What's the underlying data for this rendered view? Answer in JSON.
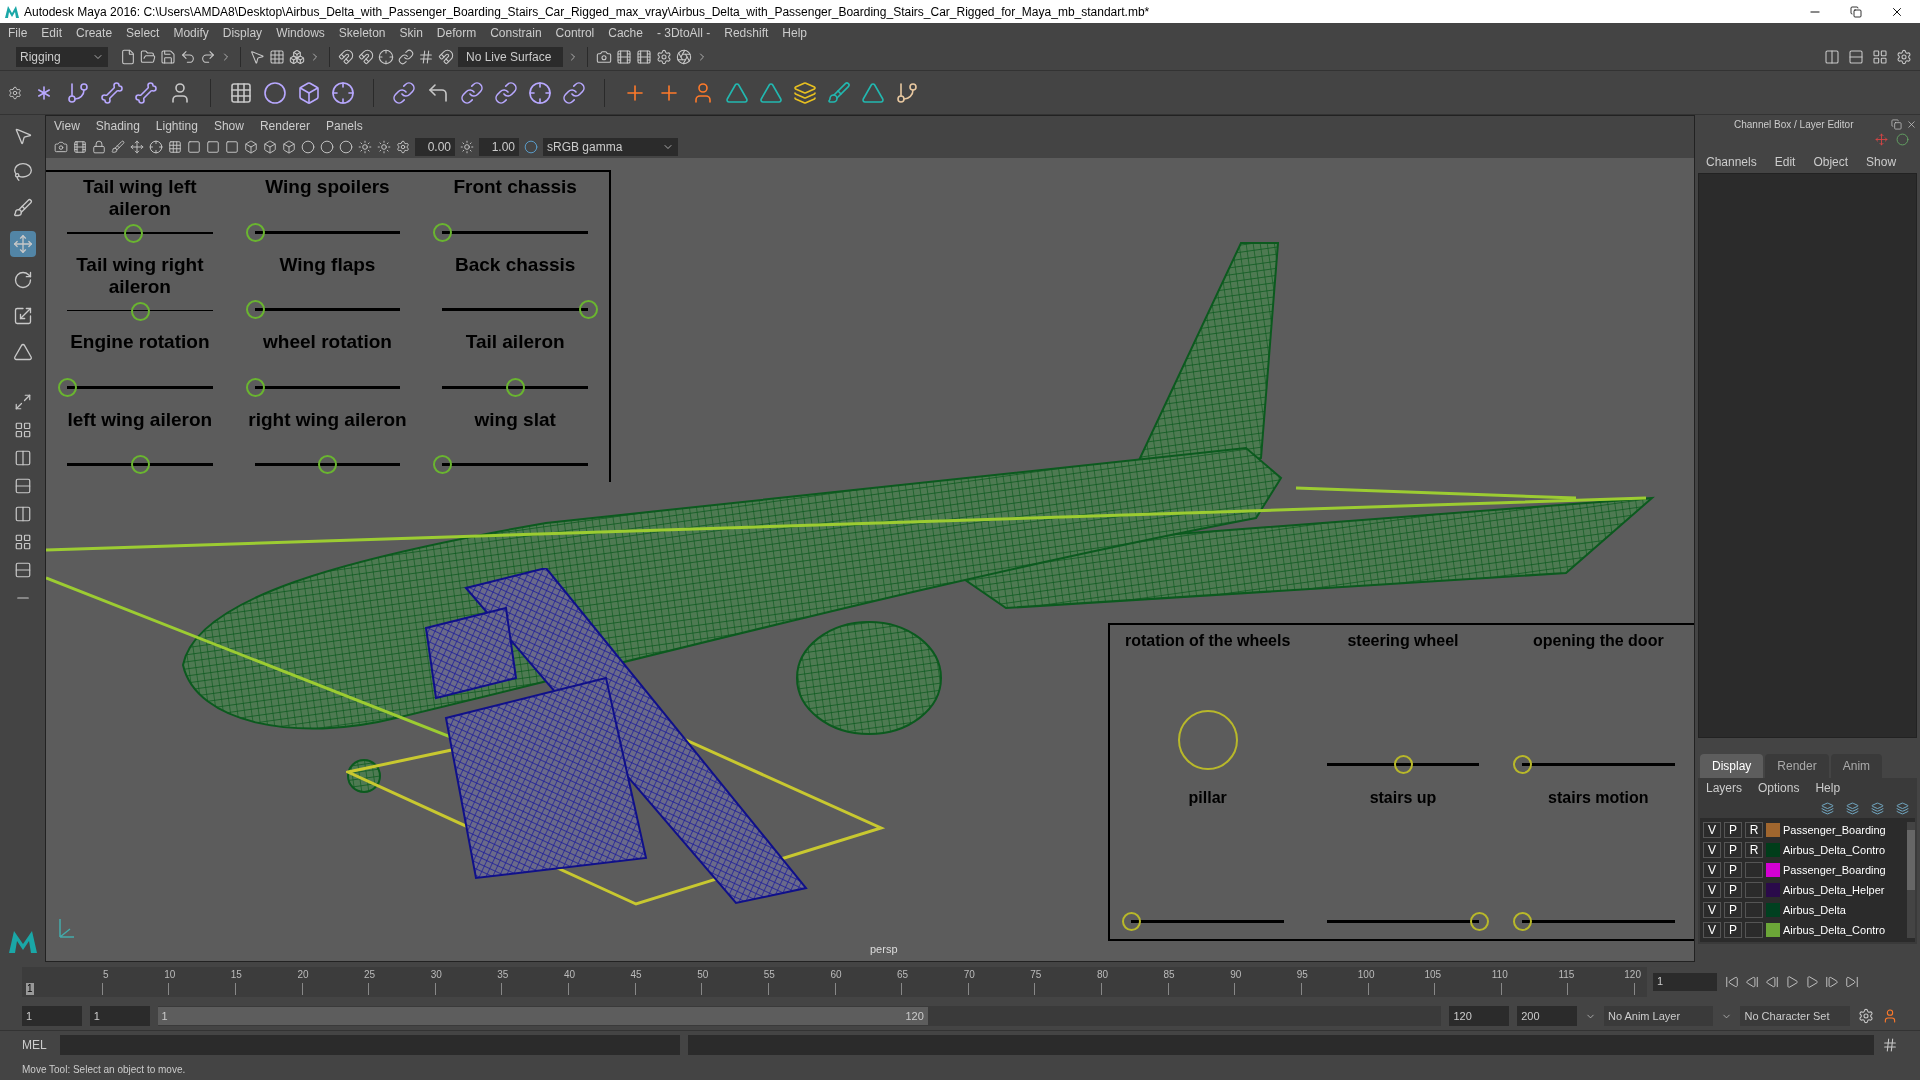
{
  "window": {
    "title": "Autodesk Maya 2016: C:\\Users\\AMDA8\\Desktop\\Airbus_Delta_with_Passenger_Boarding_Stairs_Car_Rigged_max_vray\\Airbus_Delta_with_Passenger_Boarding_Stairs_Car_Rigged_for_Maya_mb_standart.mb*"
  },
  "menu_bar": [
    "File",
    "Edit",
    "Create",
    "Select",
    "Modify",
    "Display",
    "Windows",
    "Skeleton",
    "Skin",
    "Deform",
    "Constrain",
    "Control",
    "Cache",
    "- 3DtoAll -",
    "Redshift",
    "Help"
  ],
  "status_line": {
    "mode": "Rigging",
    "live_surface": "No Live Surface"
  },
  "viewport": {
    "menu": [
      "View",
      "Shading",
      "Lighting",
      "Show",
      "Renderer",
      "Panels"
    ],
    "exposure": "0.00",
    "gamma": "1.00",
    "color_space": "sRGB gamma",
    "camera": "persp",
    "rig_panels": [
      {
        "controls": [
          {
            "label": "Tail wing left aileron",
            "kind": "slider",
            "level": 0.45
          },
          {
            "label": "Wing spoilers",
            "kind": "slider",
            "level": 0
          },
          {
            "label": "Front chassis",
            "kind": "slider",
            "level": 0
          },
          {
            "label": "Tail wing right aileron",
            "kind": "slider",
            "level": 0.5
          },
          {
            "label": "Wing flaps",
            "kind": "slider",
            "level": 0
          },
          {
            "label": "Back chassis",
            "kind": "slider",
            "level": 1
          },
          {
            "label": "Engine rotation",
            "kind": "slider",
            "level": 0
          },
          {
            "label": "wheel rotation",
            "kind": "slider",
            "level": 0
          },
          {
            "label": "Tail aileron",
            "kind": "slider",
            "level": 0.5
          },
          {
            "label": "left wing aileron",
            "kind": "slider",
            "level": 0.5
          },
          {
            "label": "right wing aileron",
            "kind": "slider",
            "level": 0.5
          },
          {
            "label": "wing slat",
            "kind": "slider",
            "level": 0
          }
        ]
      },
      {
        "controls": [
          {
            "label": "rotation of the wheels",
            "kind": "dial"
          },
          {
            "label": "steering wheel",
            "kind": "slider",
            "level": 0.5
          },
          {
            "label": "opening the door",
            "kind": "slider",
            "level": 0
          },
          {
            "label": "pillar",
            "kind": "slider",
            "level": 0
          },
          {
            "label": "stairs up",
            "kind": "slider",
            "level": 1
          },
          {
            "label": "stairs motion",
            "kind": "slider",
            "level": 0
          }
        ]
      }
    ]
  },
  "channel_box": {
    "title": "Channel Box / Layer Editor",
    "menu": [
      "Channels",
      "Edit",
      "Object",
      "Show"
    ]
  },
  "layer_editor": {
    "tabs": [
      {
        "label": "Display",
        "selected": true
      },
      {
        "label": "Render",
        "selected": false
      },
      {
        "label": "Anim",
        "selected": false
      }
    ],
    "menu": [
      "Layers",
      "Options",
      "Help"
    ],
    "layers": [
      {
        "visible": "V",
        "playback": "P",
        "reference": "R",
        "name": "Passenger_Boarding",
        "color": "#a0662e"
      },
      {
        "visible": "V",
        "playback": "P",
        "reference": "R",
        "name": "Airbus_Delta_Contro",
        "color": "#003d1a"
      },
      {
        "visible": "V",
        "playback": "P",
        "name": "Passenger_Boarding",
        "color": "#d400d4"
      },
      {
        "visible": "V",
        "playback": "P",
        "name": "Airbus_Delta_Helper",
        "color": "#2a0a4a"
      },
      {
        "visible": "V",
        "playback": "P",
        "name": "Airbus_Delta",
        "color": "#004020"
      },
      {
        "visible": "V",
        "playback": "P",
        "name": "Airbus_Delta_Contro",
        "color": "#6ca638"
      }
    ]
  },
  "timeline": {
    "marker": "1",
    "level": 0,
    "ticks": [
      "5",
      "10",
      "15",
      "20",
      "25",
      "30",
      "35",
      "40",
      "45",
      "50",
      "55",
      "60",
      "65",
      "70",
      "75",
      "80",
      "85",
      "90",
      "95",
      "100",
      "105",
      "110",
      "115",
      "120"
    ],
    "current_frame": "1"
  },
  "range": {
    "start": "1",
    "playback_start": "1",
    "slider_start": "1",
    "slider_end": "120",
    "level": 0.6,
    "playback_end": "120",
    "end": "200",
    "anim_layer": "No Anim Layer",
    "character_set": "No Character Set"
  },
  "command_line": {
    "language": "MEL"
  },
  "help_line": "Move Tool: Select an object to move."
}
